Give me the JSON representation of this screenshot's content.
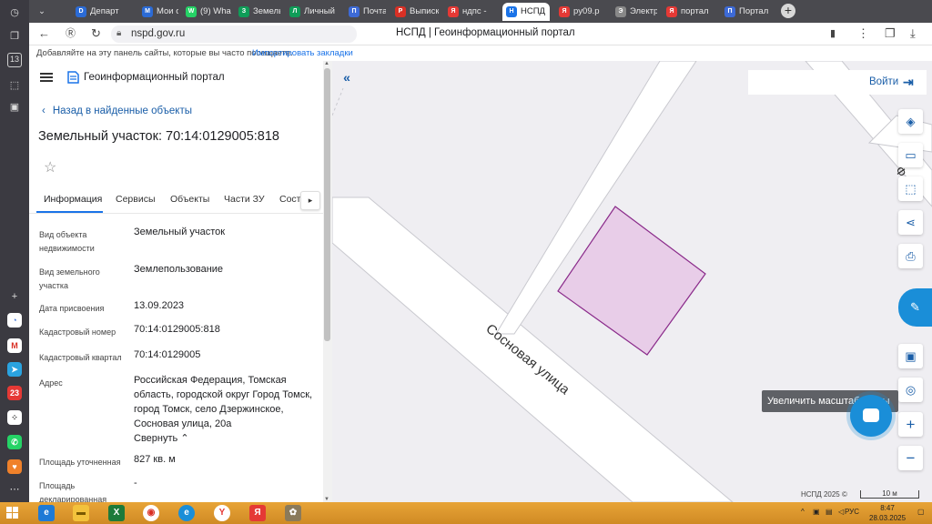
{
  "browser": {
    "tabs": [
      {
        "label": "Департ",
        "fav": "D",
        "color": "#2b6bd6"
      },
      {
        "label": "Мои об",
        "fav": "M",
        "color": "#2b6bd6"
      },
      {
        "label": "(9) Wha",
        "fav": "W",
        "color": "#25d366"
      },
      {
        "label": "Земель",
        "fav": "З",
        "color": "#0f9d58"
      },
      {
        "label": "Личный",
        "fav": "Л",
        "color": "#0f9d58"
      },
      {
        "label": "Почта I",
        "fav": "П",
        "color": "#3d6ad6"
      },
      {
        "label": "Выписк",
        "fav": "P",
        "color": "#d93025"
      },
      {
        "label": "ндпс -",
        "fav": "Я",
        "color": "#e53935"
      },
      {
        "label": "НСПД",
        "fav": "Н",
        "color": "#1a73e8"
      },
      {
        "label": "py09.p",
        "fav": "Я",
        "color": "#e53935"
      },
      {
        "label": "Электр",
        "fav": "Э",
        "color": "#888888"
      },
      {
        "label": "портал",
        "fav": "Я",
        "color": "#e53935"
      },
      {
        "label": "Портал",
        "fav": "П",
        "color": "#3d6ad6"
      }
    ],
    "url": "nspd.gov.ru",
    "page_title": "НСПД | Геоинформационный портал",
    "bookmarks_hint": "Добавляйте на эту панель сайты, которые вы часто посещаете.",
    "bookmarks_import": "Импортировать закладки",
    "rail_counter": "13"
  },
  "panel": {
    "portal_name": "Геоинформационный портал",
    "back_label": "Назад в найденные объекты",
    "object_title": "Земельный участок: 70:14:0129005:818",
    "tabs": [
      "Информация",
      "Сервисы",
      "Объекты",
      "Части ЗУ",
      "Соста"
    ],
    "fields": [
      {
        "label": "Вид объекта недвижимости",
        "value": "Земельный участок"
      },
      {
        "label": "Вид земельного участка",
        "value": "Землепользование"
      },
      {
        "label": "Дата присвоения",
        "value": "13.09.2023"
      },
      {
        "label": "Кадастровый номер",
        "value": "70:14:0129005:818"
      },
      {
        "label": "Кадастровый квартал",
        "value": "70:14:0129005"
      },
      {
        "label": "Адрес",
        "value": "Российская Федерация, Томская область, городской округ Город Томск, город Томск, село Дзержинское, Сосновая улица, 20а"
      },
      {
        "label": "Площадь уточненная",
        "value": "827 кв. м"
      },
      {
        "label": "Площадь декларированная",
        "value": "-"
      }
    ],
    "collapse_label": "Свернуть"
  },
  "map": {
    "street_label": "Сосновая улица",
    "login_label": "Войти",
    "tooltip": "Увеличить масштаб карты",
    "copyright": "НСПД 2025 ©",
    "scale": "10 м",
    "parcel_fill": "#e8cde8",
    "parcel_stroke": "#8a2a8a"
  },
  "taskbar": {
    "lang": "РУС",
    "time": "8:47",
    "date": "28.03.2025"
  }
}
